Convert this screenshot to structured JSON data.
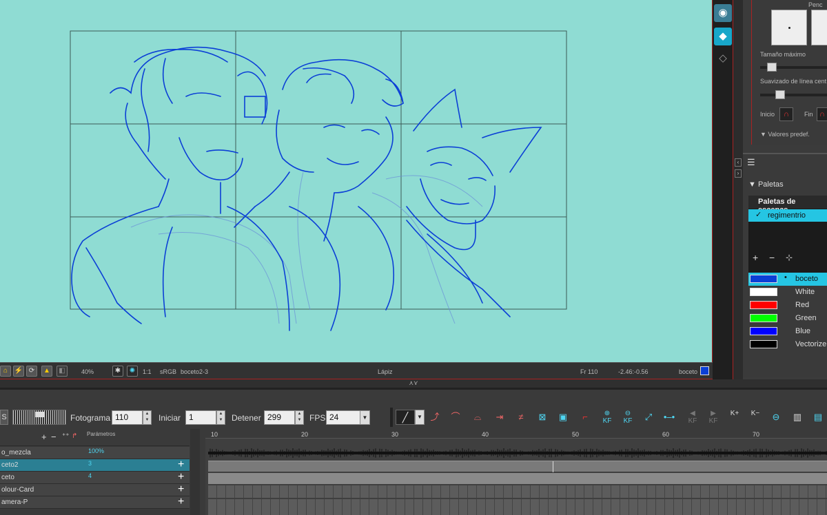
{
  "status_bar": {
    "zoom": "40%",
    "ratio": "1:1",
    "color_space": "sRGB",
    "drawing": "boceto2-3",
    "tool": "Lápiz",
    "frame": "Fr 110",
    "coords": "-2.46:-0.56",
    "palette_color_name": "boceto",
    "palette_color_hex": "#0b3fd6"
  },
  "pencil_panel": {
    "header": "Penc",
    "max_size_label": "Tamaño máximo",
    "smoothing_label": "Suavizado de línea cent",
    "start_label": "Inicio",
    "end_label": "Fin",
    "presets_label": "Valores predef."
  },
  "palette_panel": {
    "section_title": "Paletas",
    "scene_palettes_label": "Paletas de escenas",
    "palette_name": "regimentrio",
    "swatches": [
      {
        "name": "boceto",
        "color": "#0b3fd6",
        "selected": true
      },
      {
        "name": "White",
        "color": "#ffffff"
      },
      {
        "name": "Red",
        "color": "#ff0000"
      },
      {
        "name": "Green",
        "color": "#00ff00"
      },
      {
        "name": "Blue",
        "color": "#0000ff"
      },
      {
        "name": "Vectorize",
        "color": "#000000"
      }
    ]
  },
  "timeline_toolbar": {
    "frame_label": "Fotograma",
    "frame_value": "110",
    "start_label": "Iniciar",
    "start_value": "1",
    "stop_label": "Detener",
    "stop_value": "299",
    "fps_label": "FPS",
    "fps_value": "24"
  },
  "timeline": {
    "params_header": "Parámetros",
    "layers": [
      {
        "name": "o_mezcla",
        "value": "100%"
      },
      {
        "name": "ceto2",
        "value": "3",
        "selected": true
      },
      {
        "name": "ceto",
        "value": "4"
      },
      {
        "name": "olour-Card",
        "value": ""
      },
      {
        "name": "amera-P",
        "value": ""
      }
    ],
    "ruler": [
      "10",
      "20",
      "30",
      "40",
      "50",
      "60",
      "70"
    ]
  }
}
